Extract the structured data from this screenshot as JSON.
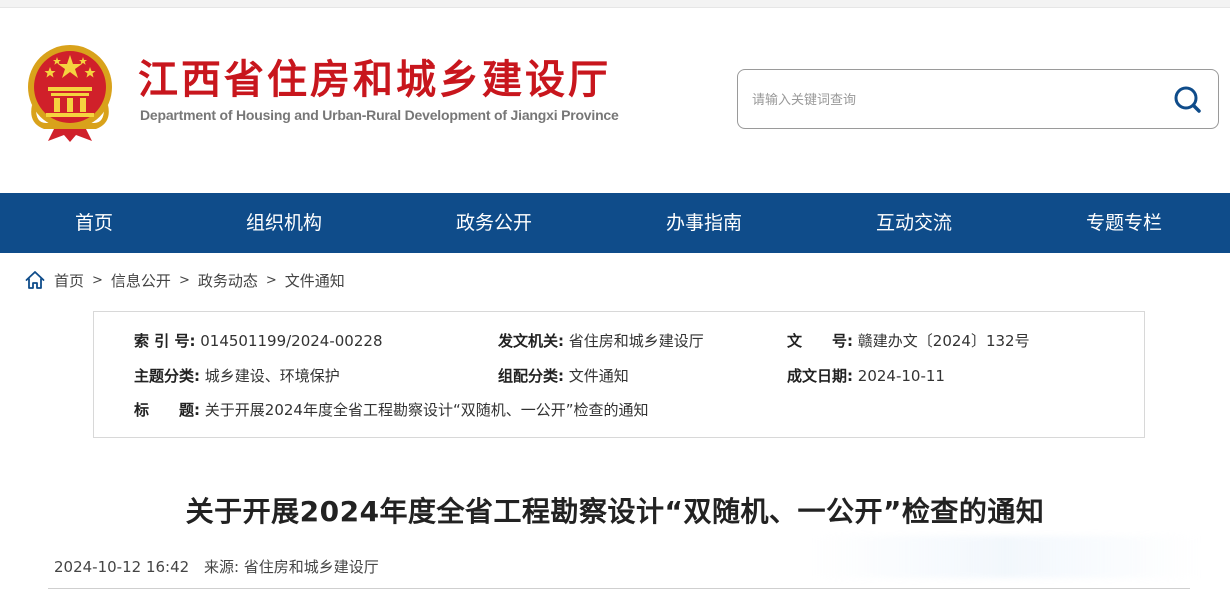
{
  "header": {
    "site_name": "江西省住房和城乡建设厅",
    "site_name_en": "Department of Housing and Urban-Rural Development of Jiangxi Province",
    "emblem_icon": "national-emblem-icon"
  },
  "search": {
    "placeholder": "请输入关键词查询",
    "icon": "search-icon"
  },
  "nav": {
    "items": [
      "首页",
      "组织机构",
      "政务公开",
      "办事指南",
      "互动交流",
      "专题专栏"
    ]
  },
  "breadcrumb": {
    "icon": "home-icon",
    "items": [
      "首页",
      "信息公开",
      "政务动态",
      "文件通知"
    ],
    "separator": ">"
  },
  "info": {
    "index_no_label": "索 引 号:",
    "index_no": "014501199/2024-00228",
    "issuer_label": "发文机关:",
    "issuer": "省住房和城乡建设厅",
    "doc_no_label": "文　　号:",
    "doc_no": "赣建办文〔2024〕132号",
    "topic_label": "主题分类:",
    "topic": "城乡建设、环境保护",
    "category_label": "组配分类:",
    "category": "文件通知",
    "date_label": "成文日期:",
    "date": "2024-10-11",
    "title_label": "标　　题:",
    "title": "关于开展2024年度全省工程勘察设计“双随机、一公开”检查的通知"
  },
  "article": {
    "title": "关于开展2024年度全省工程勘察设计“双随机、一公开”检查的通知",
    "publish_time": "2024-10-12 16:42",
    "source_label": "来源:",
    "source": "省住房和城乡建设厅"
  },
  "colors": {
    "brand_red": "#c8161d",
    "nav_blue": "#0f4c8a"
  }
}
